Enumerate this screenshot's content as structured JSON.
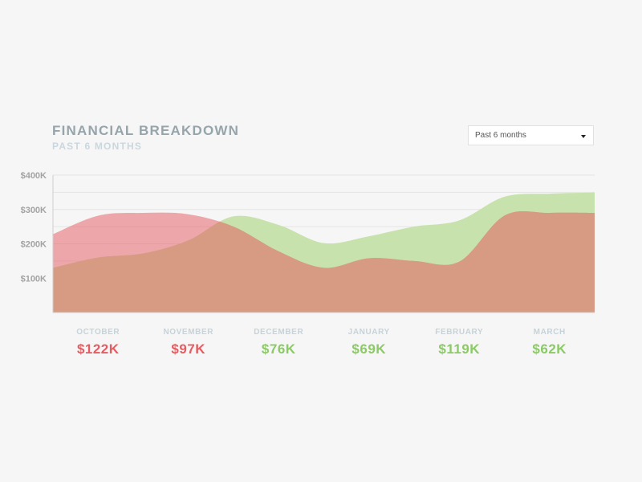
{
  "header": {
    "title": "FINANCIAL BREAKDOWN",
    "subtitle": "PAST 6 MONTHS"
  },
  "period_select": {
    "value": "Past 6 months",
    "icon": "caret-down-icon"
  },
  "colors": {
    "positive": "#8cc967",
    "negative": "#e45d62",
    "green_area": "#c7e2ac",
    "red_area": "#e6666c",
    "overlap_area": "#d79a82"
  },
  "chart_data": {
    "type": "area",
    "ylim": [
      0,
      400000
    ],
    "yticks": [
      {
        "value": 400000,
        "label": "$400K"
      },
      {
        "value": 300000,
        "label": "$300K"
      },
      {
        "value": 200000,
        "label": "$200K"
      },
      {
        "value": 100000,
        "label": "$100K"
      }
    ],
    "grid": true,
    "months": [
      "OCTOBER",
      "NOVEMBER",
      "DECEMBER",
      "JANUARY",
      "FEBRUARY",
      "MARCH"
    ],
    "month_values": [
      {
        "label": "$122K",
        "status": "negative"
      },
      {
        "label": "$97K",
        "status": "negative"
      },
      {
        "label": "$76K",
        "status": "positive"
      },
      {
        "label": "$69K",
        "status": "positive"
      },
      {
        "label": "$119K",
        "status": "positive"
      },
      {
        "label": "$62K",
        "status": "positive"
      }
    ],
    "series": [
      {
        "color_key": "green_area",
        "points": [
          [
            0.0,
            130000
          ],
          [
            0.5,
            160000
          ],
          [
            1.0,
            172000
          ],
          [
            1.5,
            210000
          ],
          [
            2.0,
            280000
          ],
          [
            2.5,
            255000
          ],
          [
            3.0,
            202000
          ],
          [
            3.5,
            222000
          ],
          [
            4.0,
            250000
          ],
          [
            4.5,
            268000
          ],
          [
            5.0,
            337000
          ],
          [
            5.5,
            346000
          ],
          [
            6.0,
            349000
          ]
        ]
      },
      {
        "color_key": "red_area",
        "points": [
          [
            0.0,
            228000
          ],
          [
            0.5,
            282000
          ],
          [
            1.0,
            290000
          ],
          [
            1.5,
            286000
          ],
          [
            2.0,
            250000
          ],
          [
            2.5,
            178000
          ],
          [
            3.0,
            130000
          ],
          [
            3.5,
            158000
          ],
          [
            4.0,
            150000
          ],
          [
            4.5,
            148000
          ],
          [
            5.0,
            282000
          ],
          [
            5.5,
            290000
          ],
          [
            6.0,
            290000
          ]
        ]
      }
    ]
  }
}
